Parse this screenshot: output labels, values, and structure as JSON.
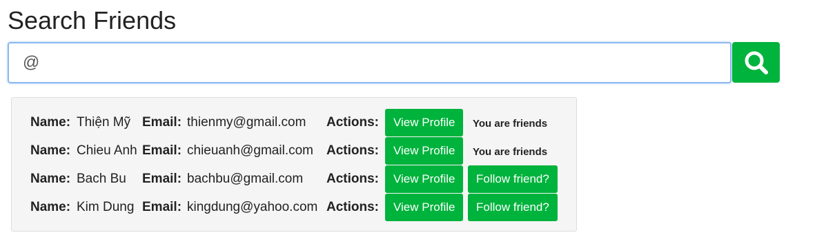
{
  "title": "Search Friends",
  "search": {
    "value": "@",
    "button_icon": "search-icon",
    "accent": "#00b33c"
  },
  "labels": {
    "name": "Name:",
    "email": "Email:",
    "actions": "Actions:"
  },
  "results": [
    {
      "name": "Thiện Mỹ",
      "email": "thienmy@gmail.com",
      "view_label": "View Profile",
      "status": "You are friends"
    },
    {
      "name": "Chieu Anh",
      "email": "chieuanh@gmail.com",
      "view_label": "View Profile",
      "status": "You are friends"
    },
    {
      "name": "Bach Bu",
      "email": "bachbu@gmail.com",
      "view_label": "View Profile",
      "follow_label": "Follow friend?"
    },
    {
      "name": "Kim Dung",
      "email": "kingdung@yahoo.com",
      "view_label": "View Profile",
      "follow_label": "Follow friend?"
    }
  ]
}
